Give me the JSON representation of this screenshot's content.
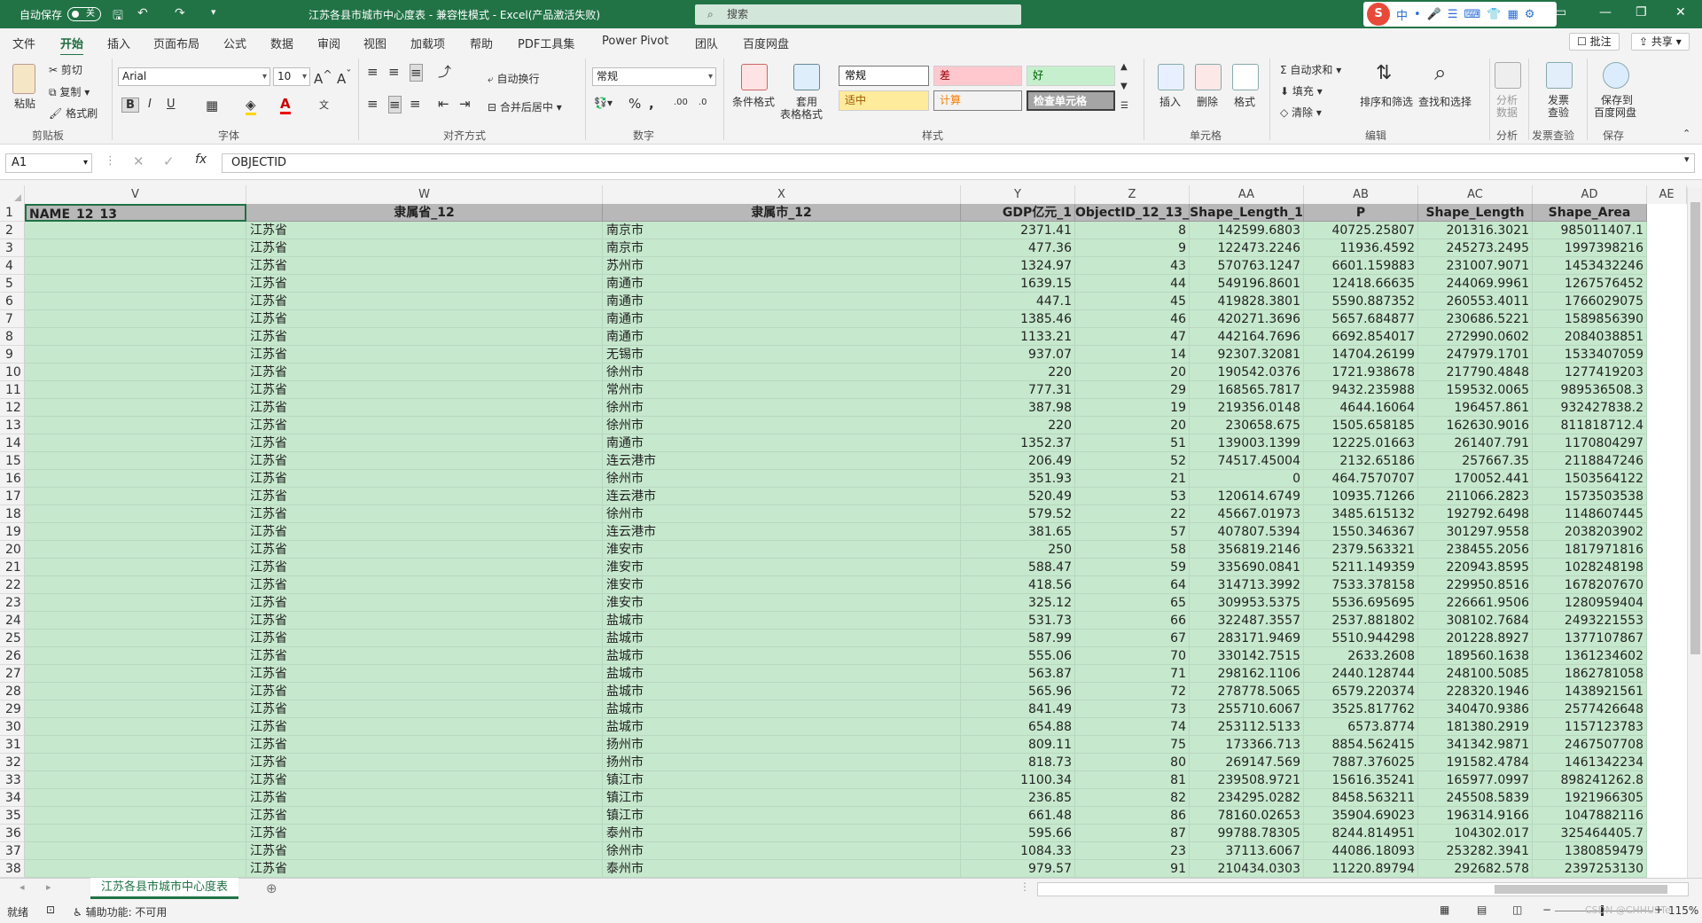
{
  "title_bar": {
    "autosave_label": "自动保存",
    "autosave_state": "关",
    "title": "江苏各县市城市中心度表 - 兼容性模式 - Excel(产品激活失败)",
    "search_placeholder": "搜索",
    "ime_chars": [
      "S",
      "中",
      "•",
      "☰",
      "⌨"
    ]
  },
  "menu": {
    "tabs": [
      "文件",
      "开始",
      "插入",
      "页面布局",
      "公式",
      "数据",
      "审阅",
      "视图",
      "加载项",
      "帮助",
      "PDF工具集",
      "Power Pivot",
      "团队",
      "百度网盘"
    ],
    "active_tab": "开始",
    "comments_label": "批注",
    "share_label": "共享"
  },
  "ribbon": {
    "clipboard": {
      "paste": "粘贴",
      "cut": "剪切",
      "copy": "复制",
      "format_painter": "格式刷",
      "group": "剪贴板"
    },
    "font": {
      "name": "Arial",
      "size": "10",
      "group": "字体"
    },
    "alignment": {
      "wrap": "自动换行",
      "merge": "合并后居中",
      "group": "对齐方式"
    },
    "number": {
      "format": "常规",
      "group": "数字"
    },
    "styles": {
      "conditional": "条件格式",
      "table_format_line1": "套用",
      "table_format_line2": "表格格式",
      "cells": [
        {
          "label": "常规",
          "bg": "#ffffff",
          "fg": "#000000"
        },
        {
          "label": "差",
          "bg": "#ffc7ce",
          "fg": "#9c0006"
        },
        {
          "label": "好",
          "bg": "#c6efce",
          "fg": "#006100"
        },
        {
          "label": "适中",
          "bg": "#ffeb9c",
          "fg": "#9c5700"
        },
        {
          "label": "计算",
          "bg": "#f2f2f2",
          "fg": "#fa7d00"
        },
        {
          "label": "检查单元格",
          "bg": "#a5a5a5",
          "fg": "#ffffff"
        }
      ],
      "group": "样式"
    },
    "cells_group": {
      "insert": "插入",
      "delete": "删除",
      "format": "格式",
      "group": "单元格"
    },
    "editing": {
      "autosum": "自动求和",
      "fill": "填充",
      "clear": "清除",
      "sort": "排序和筛选",
      "find": "查找和选择",
      "group": "编辑"
    },
    "analysis": {
      "label_line1": "分析",
      "label_line2": "数据",
      "group": "分析"
    },
    "invoice": {
      "label_line1": "发票",
      "label_line2": "查验",
      "group": "发票查验"
    },
    "save": {
      "label_line1": "保存到",
      "label_line2": "百度网盘",
      "group": "保存"
    }
  },
  "formula_bar": {
    "name_box": "A1",
    "content": "OBJECTID",
    "fx": "fx"
  },
  "columns": [
    "V",
    "W",
    "X",
    "Y",
    "Z",
    "AA",
    "AB",
    "AC",
    "AD",
    "AE"
  ],
  "header_row": {
    "num": "1",
    "cells": [
      "NAME_12_13",
      "隶属省_12",
      "隶属市_12",
      "GDP亿元_1",
      "ObjectID_12_13_14",
      "Shape_Length_1",
      "P",
      "Shape_Length",
      "Shape_Area"
    ]
  },
  "rows": [
    {
      "n": "2",
      "w": "江苏省",
      "x": "南京市",
      "y": "2371.41",
      "z": "8",
      "aa": "142599.6803",
      "ab": "40725.25807",
      "ac": "201316.3021",
      "ad": "985011407.1"
    },
    {
      "n": "3",
      "w": "江苏省",
      "x": "南京市",
      "y": "477.36",
      "z": "9",
      "aa": "122473.2246",
      "ab": "11936.4592",
      "ac": "245273.2495",
      "ad": "1997398216"
    },
    {
      "n": "4",
      "w": "江苏省",
      "x": "苏州市",
      "y": "1324.97",
      "z": "43",
      "aa": "570763.1247",
      "ab": "6601.159883",
      "ac": "231007.9071",
      "ad": "1453432246"
    },
    {
      "n": "5",
      "w": "江苏省",
      "x": "南通市",
      "y": "1639.15",
      "z": "44",
      "aa": "549196.8601",
      "ab": "12418.66635",
      "ac": "244069.9961",
      "ad": "1267576452"
    },
    {
      "n": "6",
      "w": "江苏省",
      "x": "南通市",
      "y": "447.1",
      "z": "45",
      "aa": "419828.3801",
      "ab": "5590.887352",
      "ac": "260553.4011",
      "ad": "1766029075"
    },
    {
      "n": "7",
      "w": "江苏省",
      "x": "南通市",
      "y": "1385.46",
      "z": "46",
      "aa": "420271.3696",
      "ab": "5657.684877",
      "ac": "230686.5221",
      "ad": "1589856390"
    },
    {
      "n": "8",
      "w": "江苏省",
      "x": "南通市",
      "y": "1133.21",
      "z": "47",
      "aa": "442164.7696",
      "ab": "6692.854017",
      "ac": "272990.0602",
      "ad": "2084038851"
    },
    {
      "n": "9",
      "w": "江苏省",
      "x": "无锡市",
      "y": "937.07",
      "z": "14",
      "aa": "92307.32081",
      "ab": "14704.26199",
      "ac": "247979.1701",
      "ad": "1533407059"
    },
    {
      "n": "10",
      "w": "江苏省",
      "x": "徐州市",
      "y": "220",
      "z": "20",
      "aa": "190542.0376",
      "ab": "1721.938678",
      "ac": "217790.4848",
      "ad": "1277419203"
    },
    {
      "n": "11",
      "w": "江苏省",
      "x": "常州市",
      "y": "777.31",
      "z": "29",
      "aa": "168565.7817",
      "ab": "9432.235988",
      "ac": "159532.0065",
      "ad": "989536508.3"
    },
    {
      "n": "12",
      "w": "江苏省",
      "x": "徐州市",
      "y": "387.98",
      "z": "19",
      "aa": "219356.0148",
      "ab": "4644.16064",
      "ac": "196457.861",
      "ad": "932427838.2"
    },
    {
      "n": "13",
      "w": "江苏省",
      "x": "徐州市",
      "y": "220",
      "z": "20",
      "aa": "230658.675",
      "ab": "1505.658185",
      "ac": "162630.9016",
      "ad": "811818712.4"
    },
    {
      "n": "14",
      "w": "江苏省",
      "x": "南通市",
      "y": "1352.37",
      "z": "51",
      "aa": "139003.1399",
      "ab": "12225.01663",
      "ac": "261407.791",
      "ad": "1170804297"
    },
    {
      "n": "15",
      "w": "江苏省",
      "x": "连云港市",
      "y": "206.49",
      "z": "52",
      "aa": "74517.45004",
      "ab": "2132.65186",
      "ac": "257667.35",
      "ad": "2118847246"
    },
    {
      "n": "16",
      "w": "江苏省",
      "x": "徐州市",
      "y": "351.93",
      "z": "21",
      "aa": "0",
      "ab": "464.7570707",
      "ac": "170052.441",
      "ad": "1503564122"
    },
    {
      "n": "17",
      "w": "江苏省",
      "x": "连云港市",
      "y": "520.49",
      "z": "53",
      "aa": "120614.6749",
      "ab": "10935.71266",
      "ac": "211066.2823",
      "ad": "1573503538"
    },
    {
      "n": "18",
      "w": "江苏省",
      "x": "徐州市",
      "y": "579.52",
      "z": "22",
      "aa": "45667.01973",
      "ab": "3485.615132",
      "ac": "192792.6498",
      "ad": "1148607445"
    },
    {
      "n": "19",
      "w": "江苏省",
      "x": "连云港市",
      "y": "381.65",
      "z": "57",
      "aa": "407807.5394",
      "ab": "1550.346367",
      "ac": "301297.9558",
      "ad": "2038203902"
    },
    {
      "n": "20",
      "w": "江苏省",
      "x": "淮安市",
      "y": "250",
      "z": "58",
      "aa": "356819.2146",
      "ab": "2379.563321",
      "ac": "238455.2056",
      "ad": "1817971816"
    },
    {
      "n": "21",
      "w": "江苏省",
      "x": "淮安市",
      "y": "588.47",
      "z": "59",
      "aa": "335690.0841",
      "ab": "5211.149359",
      "ac": "220943.8595",
      "ad": "1028248198"
    },
    {
      "n": "22",
      "w": "江苏省",
      "x": "淮安市",
      "y": "418.56",
      "z": "64",
      "aa": "314713.3992",
      "ab": "7533.378158",
      "ac": "229950.8516",
      "ad": "1678207670"
    },
    {
      "n": "23",
      "w": "江苏省",
      "x": "淮安市",
      "y": "325.12",
      "z": "65",
      "aa": "309953.5375",
      "ab": "5536.695695",
      "ac": "226661.9506",
      "ad": "1280959404"
    },
    {
      "n": "24",
      "w": "江苏省",
      "x": "盐城市",
      "y": "531.73",
      "z": "66",
      "aa": "322487.3557",
      "ab": "2537.881802",
      "ac": "308102.7684",
      "ad": "2493221553"
    },
    {
      "n": "25",
      "w": "江苏省",
      "x": "盐城市",
      "y": "587.99",
      "z": "67",
      "aa": "283171.9469",
      "ab": "5510.944298",
      "ac": "201228.8927",
      "ad": "1377107867"
    },
    {
      "n": "26",
      "w": "江苏省",
      "x": "盐城市",
      "y": "555.06",
      "z": "70",
      "aa": "330142.7515",
      "ab": "2633.2608",
      "ac": "189560.1638",
      "ad": "1361234602"
    },
    {
      "n": "27",
      "w": "江苏省",
      "x": "盐城市",
      "y": "563.87",
      "z": "71",
      "aa": "298162.1106",
      "ab": "2440.128744",
      "ac": "248100.5085",
      "ad": "1862781058"
    },
    {
      "n": "28",
      "w": "江苏省",
      "x": "盐城市",
      "y": "565.96",
      "z": "72",
      "aa": "278778.5065",
      "ab": "6579.220374",
      "ac": "228320.1946",
      "ad": "1438921561"
    },
    {
      "n": "29",
      "w": "江苏省",
      "x": "盐城市",
      "y": "841.49",
      "z": "73",
      "aa": "255710.6067",
      "ab": "3525.817762",
      "ac": "340470.9386",
      "ad": "2577426648"
    },
    {
      "n": "30",
      "w": "江苏省",
      "x": "盐城市",
      "y": "654.88",
      "z": "74",
      "aa": "253112.5133",
      "ab": "6573.8774",
      "ac": "181380.2919",
      "ad": "1157123783"
    },
    {
      "n": "31",
      "w": "江苏省",
      "x": "扬州市",
      "y": "809.11",
      "z": "75",
      "aa": "173366.713",
      "ab": "8854.562415",
      "ac": "341342.9871",
      "ad": "2467507708"
    },
    {
      "n": "32",
      "w": "江苏省",
      "x": "扬州市",
      "y": "818.73",
      "z": "80",
      "aa": "269147.569",
      "ab": "7887.376025",
      "ac": "191582.4784",
      "ad": "1461342234"
    },
    {
      "n": "33",
      "w": "江苏省",
      "x": "镇江市",
      "y": "1100.34",
      "z": "81",
      "aa": "239508.9721",
      "ab": "15616.35241",
      "ac": "165977.0997",
      "ad": "898241262.8"
    },
    {
      "n": "34",
      "w": "江苏省",
      "x": "镇江市",
      "y": "236.85",
      "z": "82",
      "aa": "234295.0282",
      "ab": "8458.563211",
      "ac": "245508.5839",
      "ad": "1921966305"
    },
    {
      "n": "35",
      "w": "江苏省",
      "x": "镇江市",
      "y": "661.48",
      "z": "86",
      "aa": "78160.02653",
      "ab": "35904.69023",
      "ac": "196314.9166",
      "ad": "1047882116"
    },
    {
      "n": "36",
      "w": "江苏省",
      "x": "泰州市",
      "y": "595.66",
      "z": "87",
      "aa": "99788.78305",
      "ab": "8244.814951",
      "ac": "104302.017",
      "ad": "325464405.7"
    },
    {
      "n": "37",
      "w": "江苏省",
      "x": "徐州市",
      "y": "1084.33",
      "z": "23",
      "aa": "37113.6067",
      "ab": "44086.18093",
      "ac": "253282.3941",
      "ad": "1380859479"
    },
    {
      "n": "38",
      "w": "江苏省",
      "x": "泰州市",
      "y": "979.57",
      "z": "91",
      "aa": "210434.0303",
      "ab": "11220.89794",
      "ac": "292682.578",
      "ad": "2397253130"
    }
  ],
  "sheet": {
    "tab_name": "江苏各县市城市中心度表"
  },
  "status": {
    "ready": "就绪",
    "accessibility": "辅助功能: 不可用",
    "watermark": "CSDN @CHHUSTe",
    "zoom": "115%"
  }
}
